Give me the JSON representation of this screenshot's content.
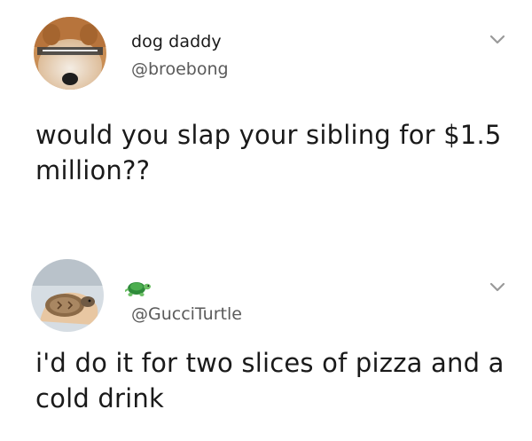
{
  "tweets": [
    {
      "display_name": "dog daddy",
      "handle": "@broebong",
      "text": "would you slap your sibling for $1.5 million??",
      "avatar_icon": "dog-avatar",
      "menu_icon": "chevron-down-icon"
    },
    {
      "display_name_icon": "turtle-emoji",
      "handle": "@GucciTurtle",
      "text": "i'd do it for two slices of pizza and a cold drink",
      "avatar_icon": "turtle-avatar",
      "menu_icon": "chevron-down-icon"
    }
  ],
  "colors": {
    "text": "#1a1a1a",
    "handle": "#5a5a5a",
    "chevron": "#9a9a9a"
  }
}
